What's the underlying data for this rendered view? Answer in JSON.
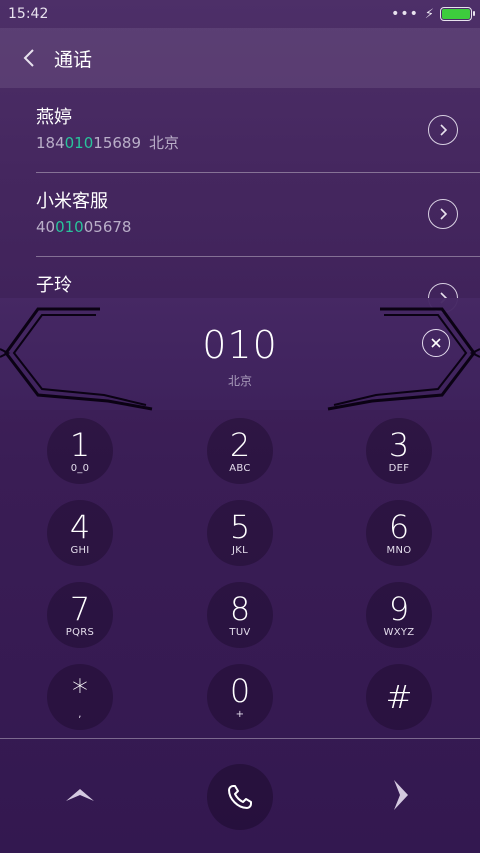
{
  "status": {
    "time": "15:42",
    "dots": "•••",
    "charging_icon": "bolt-icon",
    "battery_level": 1.0,
    "battery_color": "#3dcc3d"
  },
  "header": {
    "back_icon": "chevron-left-icon",
    "title": "通话"
  },
  "results": [
    {
      "name": "燕婷",
      "number_pre": "184",
      "number_match": "010",
      "number_post": "15689",
      "location": "北京"
    },
    {
      "name": "小米客服",
      "number_pre": "40",
      "number_match": "010",
      "number_post": "05678",
      "location": ""
    },
    {
      "name": "子玲",
      "number_pre": "",
      "number_match": "",
      "number_post": "",
      "location": ""
    }
  ],
  "dialer": {
    "digits": "010",
    "location": "北京",
    "clear_icon": "close-icon"
  },
  "keypad": [
    {
      "num": "1",
      "letters": "0_0"
    },
    {
      "num": "2",
      "letters": "ABC"
    },
    {
      "num": "3",
      "letters": "DEF"
    },
    {
      "num": "4",
      "letters": "GHI"
    },
    {
      "num": "5",
      "letters": "JKL"
    },
    {
      "num": "6",
      "letters": "MNO"
    },
    {
      "num": "7",
      "letters": "PQRS"
    },
    {
      "num": "8",
      "letters": "TUV"
    },
    {
      "num": "9",
      "letters": "WXYZ"
    },
    {
      "num": "*",
      "letters": ","
    },
    {
      "num": "0",
      "letters": "+"
    },
    {
      "num": "#",
      "letters": ""
    }
  ],
  "bottom": {
    "collapse_icon": "chevron-up-icon",
    "call_icon": "phone-icon",
    "next_icon": "chevron-right-icon"
  },
  "colors": {
    "match_highlight": "#29c49b",
    "background": "#3a1d55"
  }
}
